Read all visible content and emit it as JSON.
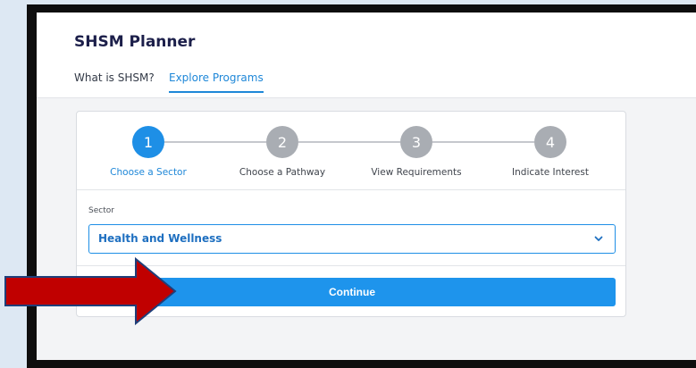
{
  "app": {
    "title": "SHSM Planner"
  },
  "nav": {
    "tabs": [
      {
        "label": "What is SHSM?"
      },
      {
        "label": "Explore Programs",
        "active": true
      }
    ]
  },
  "steps": [
    {
      "number": "1",
      "label": "Choose a Sector",
      "active": true
    },
    {
      "number": "2",
      "label": "Choose a Pathway",
      "active": false
    },
    {
      "number": "3",
      "label": "View Requirements",
      "active": false
    },
    {
      "number": "4",
      "label": "Indicate Interest",
      "active": false
    }
  ],
  "form": {
    "sector_label": "Sector",
    "sector_value": "Health and Wellness"
  },
  "actions": {
    "continue_label": "Continue"
  },
  "colors": {
    "accent": "#1e8fe6",
    "title": "#1c1f4a",
    "arrow": "#c00000",
    "inactive_step": "#a9adb3"
  }
}
